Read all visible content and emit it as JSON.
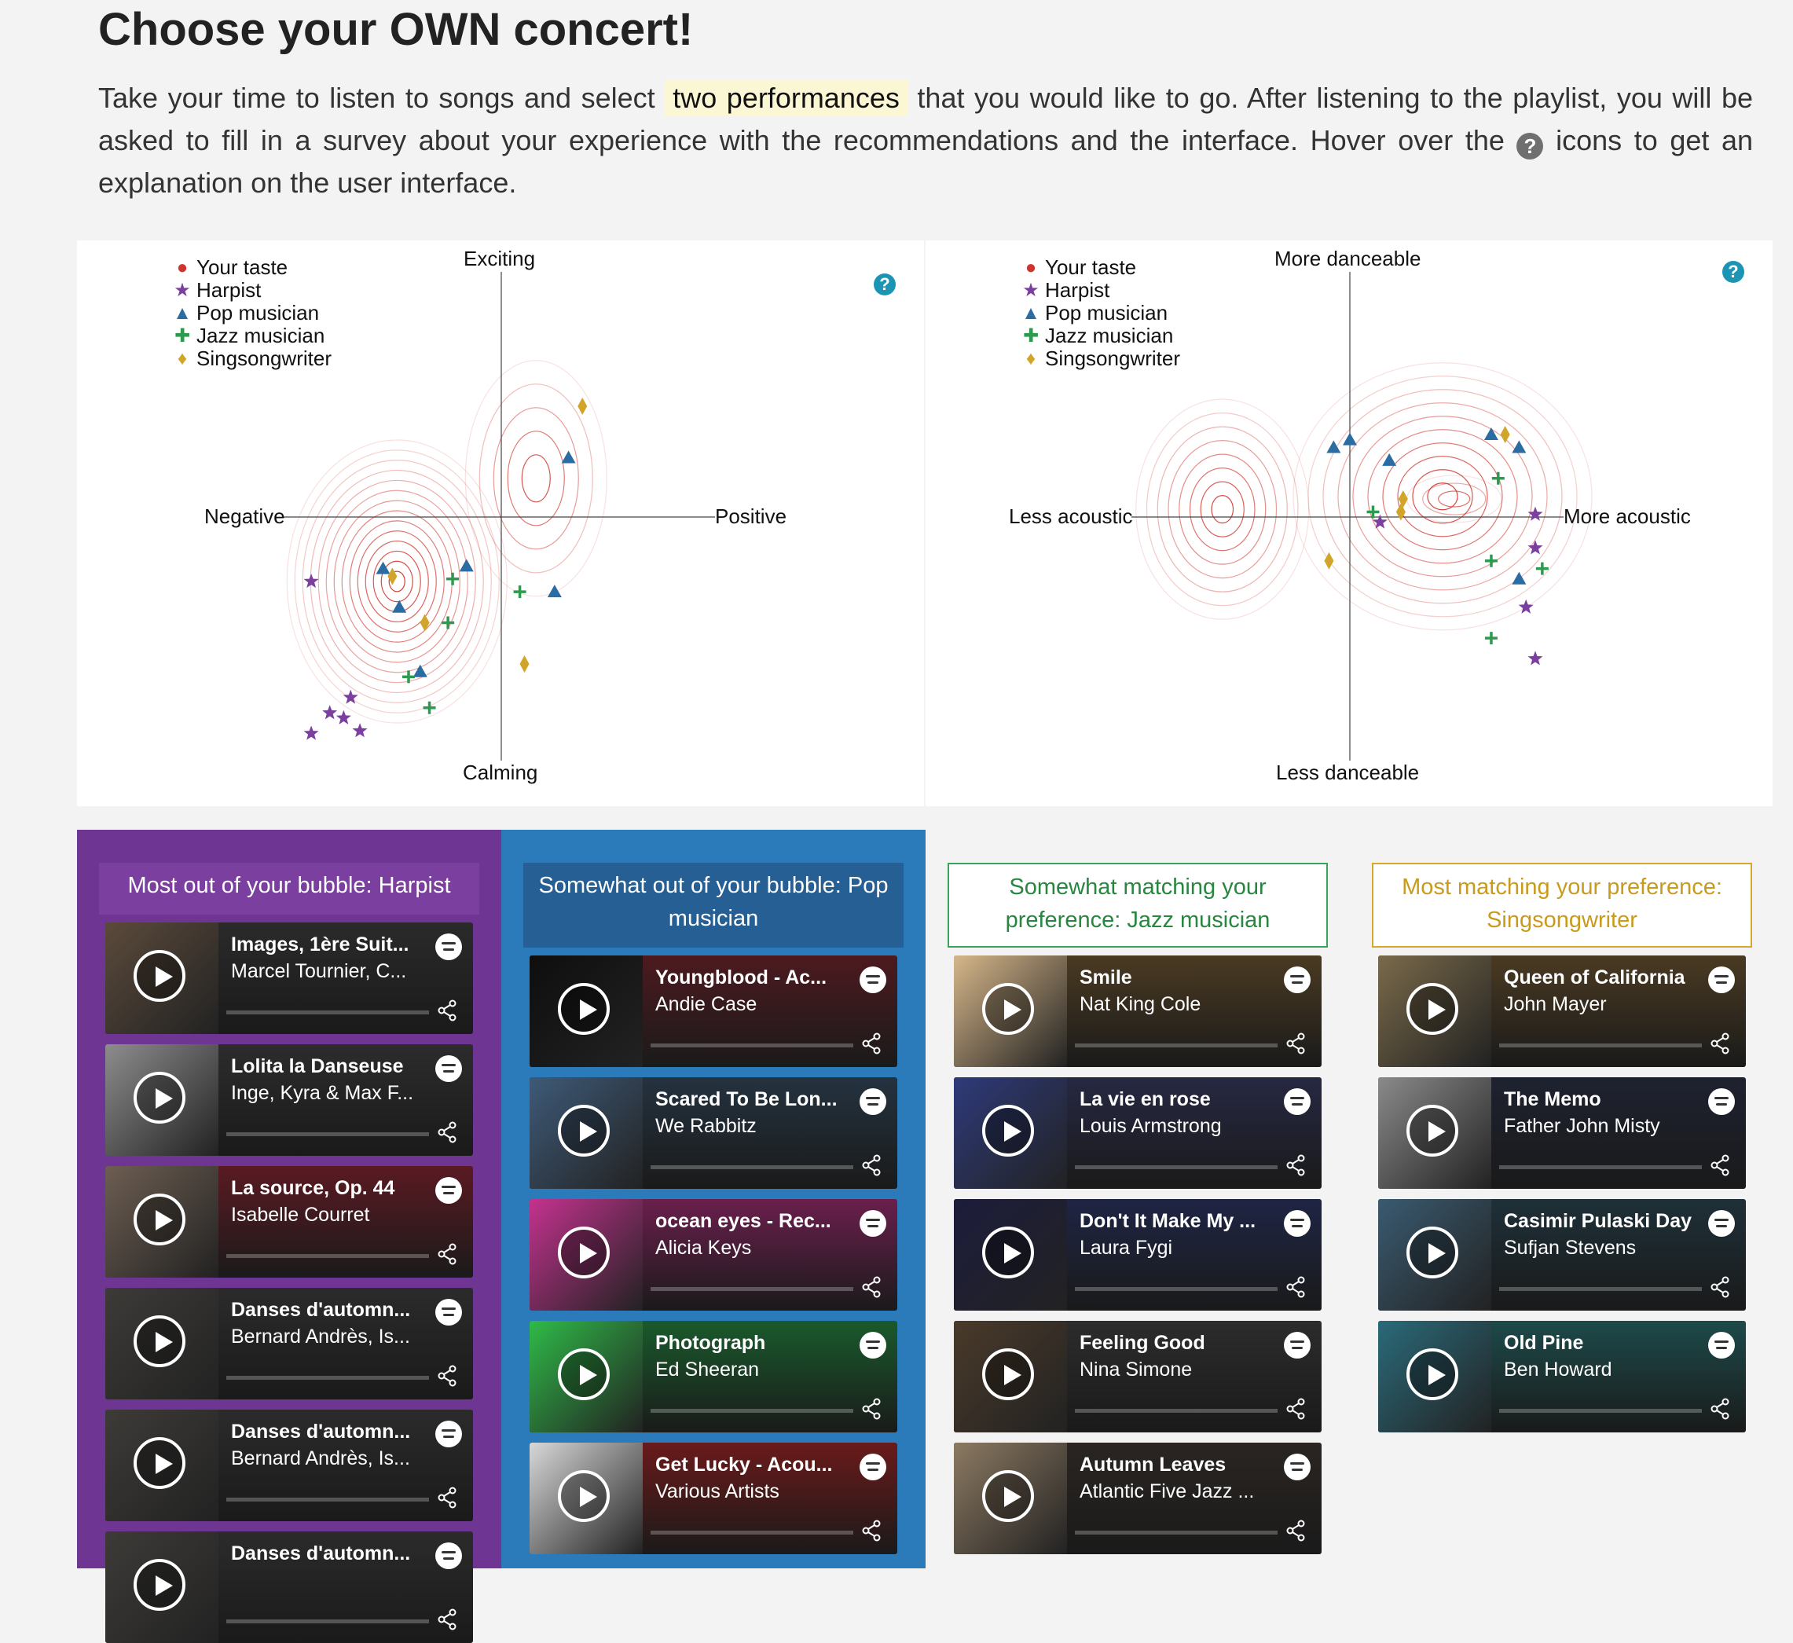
{
  "page": {
    "title": "Choose your OWN concert!",
    "intro_part1": "Take your time to listen to songs and select ",
    "intro_highlight": "two performances",
    "intro_part2": " that you would like to go. After listening to the playlist, you will be asked to fill in a survey about your experience with the recommendations and the interface. Hover over the ",
    "intro_icon": "?",
    "intro_part3": " icons to get an explanation on the user interface."
  },
  "legend": [
    {
      "label": "Your taste",
      "symbol": "●",
      "color": "#d0342c"
    },
    {
      "label": "Harpist",
      "symbol": "★",
      "color": "#7b3fa0"
    },
    {
      "label": "Pop musician",
      "symbol": "▲",
      "color": "#2b6ca3"
    },
    {
      "label": "Jazz musician",
      "symbol": "✚",
      "color": "#2e9a4f"
    },
    {
      "label": "Singsongwriter",
      "symbol": "♦",
      "color": "#d1a52a"
    }
  ],
  "plots": {
    "left": {
      "top": "Exciting",
      "bottom": "Calming",
      "left": "Negative",
      "right": "Positive",
      "help": "?"
    },
    "right": {
      "top": "More danceable",
      "bottom": "Less danceable",
      "left": "Less acoustic",
      "right": "More acoustic",
      "help": "?"
    }
  },
  "chart_data": [
    {
      "type": "scatter",
      "xlabel_left": "Negative",
      "xlabel_right": "Positive",
      "ylabel_top": "Exciting",
      "ylabel_bottom": "Calming",
      "xlim": [
        -1,
        1
      ],
      "ylim": [
        -1,
        1
      ],
      "series": [
        {
          "name": "Harpist",
          "points": [
            [
              -0.82,
              -0.25
            ],
            [
              -0.65,
              -0.7
            ],
            [
              -0.74,
              -0.76
            ],
            [
              -0.68,
              -0.78
            ],
            [
              -0.82,
              -0.84
            ],
            [
              -0.61,
              -0.83
            ]
          ]
        },
        {
          "name": "Pop musician",
          "points": [
            [
              0.29,
              0.23
            ],
            [
              -0.51,
              -0.2
            ],
            [
              -0.44,
              -0.35
            ],
            [
              -0.15,
              -0.19
            ],
            [
              0.23,
              -0.29
            ],
            [
              -0.35,
              -0.6
            ]
          ]
        },
        {
          "name": "Jazz musician",
          "points": [
            [
              -0.21,
              -0.24
            ],
            [
              -0.23,
              -0.41
            ],
            [
              0.08,
              -0.29
            ],
            [
              -0.4,
              -0.62
            ],
            [
              -0.31,
              -0.74
            ]
          ]
        },
        {
          "name": "Singsongwriter",
          "points": [
            [
              0.35,
              0.43
            ],
            [
              -0.47,
              -0.23
            ],
            [
              -0.33,
              -0.41
            ],
            [
              0.1,
              -0.57
            ]
          ]
        }
      ]
    },
    {
      "type": "scatter",
      "xlabel_left": "Less acoustic",
      "xlabel_right": "More acoustic",
      "ylabel_top": "More danceable",
      "ylabel_bottom": "Less danceable",
      "xlim": [
        -1,
        1
      ],
      "ylim": [
        -1,
        1
      ],
      "series": [
        {
          "name": "Harpist",
          "points": [
            [
              0.13,
              -0.02
            ],
            [
              0.8,
              0.01
            ],
            [
              0.8,
              -0.12
            ],
            [
              0.76,
              -0.35
            ],
            [
              0.8,
              -0.55
            ]
          ]
        },
        {
          "name": "Pop musician",
          "points": [
            [
              -0.07,
              0.27
            ],
            [
              0.0,
              0.3
            ],
            [
              0.17,
              0.22
            ],
            [
              0.61,
              0.32
            ],
            [
              0.73,
              0.27
            ],
            [
              0.73,
              -0.24
            ]
          ]
        },
        {
          "name": "Jazz musician",
          "points": [
            [
              0.1,
              0.02
            ],
            [
              0.64,
              0.15
            ],
            [
              0.61,
              -0.17
            ],
            [
              0.83,
              -0.2
            ],
            [
              0.61,
              -0.47
            ]
          ]
        },
        {
          "name": "Singsongwriter",
          "points": [
            [
              0.67,
              0.32
            ],
            [
              0.22,
              0.02
            ],
            [
              0.23,
              0.07
            ],
            [
              -0.09,
              -0.17
            ]
          ]
        }
      ]
    }
  ],
  "columns": [
    {
      "header": "Most out of your bubble: Harpist",
      "tracks": [
        {
          "title": "Images, 1ère Suit...",
          "artist": "Marcel Tournier, C...",
          "bg": "#2a2a2a",
          "cover": "#5b4a3b"
        },
        {
          "title": "Lolita la Danseuse",
          "artist": "Inge, Kyra & Max F...",
          "bg": "#2c2c2c",
          "cover": "#8d8d8d"
        },
        {
          "title": "La source, Op. 44",
          "artist": "Isabelle Courret",
          "bg": "#5a1a22",
          "cover": "#6d5e52"
        },
        {
          "title": "Danses d'automn...",
          "artist": "Bernard Andrès, Is...",
          "bg": "#2b2b2b",
          "cover": "#3d3b38"
        },
        {
          "title": "Danses d'automn...",
          "artist": "Bernard Andrès, Is...",
          "bg": "#2b2b2b",
          "cover": "#3d3b38"
        },
        {
          "title": "Danses d'automn...",
          "artist": "",
          "bg": "#2b2b2b",
          "cover": "#3d3b38"
        }
      ]
    },
    {
      "header": "Somewhat out of your bubble: Pop musician",
      "tracks": [
        {
          "title": "Youngblood - Ac...",
          "artist": "Andie Case",
          "bg": "#4c1a1f",
          "cover": "#0e0e0e"
        },
        {
          "title": "Scared To Be Lon...",
          "artist": "We Rabbitz",
          "bg": "#24323f",
          "cover": "#3e5a78"
        },
        {
          "title": "ocean eyes - Rec...",
          "artist": "Alicia Keys",
          "bg": "#6a1f4d",
          "cover": "#c4328f"
        },
        {
          "title": "Photograph",
          "artist": "Ed Sheeran",
          "bg": "#1a5a2c",
          "cover": "#2fba48"
        },
        {
          "title": "Get Lucky - Acou...",
          "artist": "Various Artists",
          "bg": "#6a1a1a",
          "cover": "#d8d8d8"
        }
      ]
    },
    {
      "header": "Somewhat matching your preference: Jazz musician",
      "tracks": [
        {
          "title": "Smile",
          "artist": "Nat King Cole",
          "bg": "#4a3a22",
          "cover": "#d7b78a"
        },
        {
          "title": "La vie en rose",
          "artist": "Louis Armstrong",
          "bg": "#262842",
          "cover": "#2e3a7a"
        },
        {
          "title": "Don't It Make My ...",
          "artist": "Laura Fygi",
          "bg": "#1e2544",
          "cover": "#1c1c3c"
        },
        {
          "title": "Feeling Good",
          "artist": "Nina Simone",
          "bg": "#2c2c2c",
          "cover": "#4a3a2a"
        },
        {
          "title": "Autumn Leaves",
          "artist": "Atlantic Five Jazz ...",
          "bg": "#2a2522",
          "cover": "#8c7a62"
        }
      ]
    },
    {
      "header": "Most matching your preference: Singsongwriter",
      "tracks": [
        {
          "title": "Queen of California",
          "artist": "John Mayer",
          "bg": "#4a3a22",
          "cover": "#7a6a4a"
        },
        {
          "title": "The Memo",
          "artist": "Father John Misty",
          "bg": "#1e2230",
          "cover": "#8a8a8a"
        },
        {
          "title": "Casimir Pulaski Day",
          "artist": "Sufjan Stevens",
          "bg": "#1e3038",
          "cover": "#3a5a70"
        },
        {
          "title": "Old Pine",
          "artist": "Ben Howard",
          "bg": "#1d4a4a",
          "cover": "#2a6a7a"
        }
      ]
    }
  ],
  "colors": {
    "purple": "#6f3593",
    "blue": "#2b7ab9",
    "green": "#3aa35a",
    "gold": "#d5aa2c",
    "help": "#1c95b5"
  }
}
